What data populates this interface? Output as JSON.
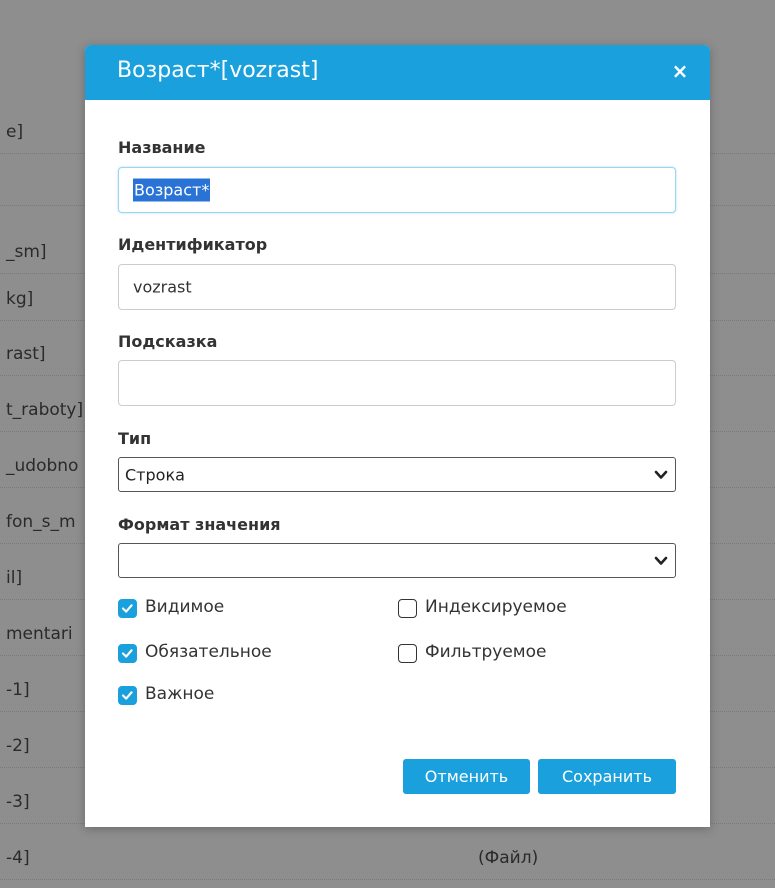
{
  "background_list": {
    "rows": [
      {
        "left": "e]",
        "right": ""
      },
      {
        "left": "",
        "right": ""
      },
      {
        "left": "_sm]",
        "right": ""
      },
      {
        "left": "kg]",
        "right": ""
      },
      {
        "left": "rast]",
        "right": ""
      },
      {
        "left": "t_raboty]",
        "right": ""
      },
      {
        "left": "_udobno",
        "right": ""
      },
      {
        "left": "fon_s_m",
        "right": ""
      },
      {
        "left": "il]",
        "right": ""
      },
      {
        "left": "mentari",
        "right": ""
      },
      {
        "left": "-1]",
        "right": ""
      },
      {
        "left": "-2]",
        "right": ""
      },
      {
        "left": "-3]",
        "right": ""
      },
      {
        "left": "-4]",
        "right": "(Файл)"
      }
    ]
  },
  "modal": {
    "title": "Возраст*[vozrast]",
    "close_glyph": "×",
    "fields": {
      "name": {
        "label": "Название",
        "value": "Возраст*"
      },
      "identifier": {
        "label": "Идентификатор",
        "value": "vozrast"
      },
      "hint": {
        "label": "Подсказка",
        "value": ""
      },
      "type": {
        "label": "Тип",
        "value": "Строка"
      },
      "format": {
        "label": "Формат значения",
        "value": ""
      }
    },
    "checkboxes": {
      "visible": {
        "label": "Видимое",
        "checked": true
      },
      "required": {
        "label": "Обязательное",
        "checked": true
      },
      "important": {
        "label": "Важное",
        "checked": true
      },
      "indexed": {
        "label": "Индексируемое",
        "checked": false
      },
      "filterable": {
        "label": "Фильтруемое",
        "checked": false
      }
    },
    "buttons": {
      "cancel": "Отменить",
      "save": "Сохранить"
    }
  },
  "colors": {
    "accent": "#1aa0dc",
    "overlay": "#8e8e8e"
  },
  "icons": {
    "close": "close-icon",
    "chevron": "chevron-down-icon",
    "check": "checkmark-icon"
  }
}
